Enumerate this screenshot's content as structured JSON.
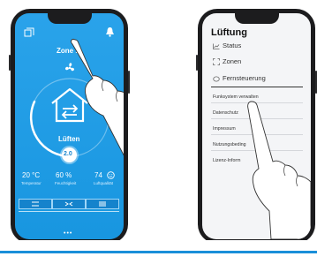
{
  "left_phone": {
    "zone_label": "Zone 1",
    "mode_label": "Lüften",
    "level_value": "2.0",
    "stats": [
      {
        "value": "20 °C",
        "label": "Temperatur"
      },
      {
        "value": "60 %",
        "label": "Feuchtigkeit"
      },
      {
        "value": "74",
        "label": "Luftqualität",
        "icon": "smiley-icon"
      }
    ],
    "mode_buttons": [
      {
        "icon": "menu-lines-icon",
        "active": false
      },
      {
        "icon": "crossflow-icon",
        "active": true
      },
      {
        "icon": "sliders-icon",
        "active": false
      }
    ],
    "page_dots": "•••",
    "icons": {
      "top_left": "rooms-icon",
      "top_right": "bell-icon",
      "fan": "fan-icon",
      "house": "house-recovery-icon"
    },
    "colors": {
      "background": "#1e9be4",
      "accent": "#ffffff"
    }
  },
  "right_phone": {
    "title": "Lüftung",
    "menu": [
      {
        "icon": "chart-icon",
        "label": "Status"
      },
      {
        "icon": "zones-icon",
        "label": "Zonen"
      },
      {
        "icon": "remote-icon",
        "label": "Fernsteuerung"
      }
    ],
    "sub_menu": [
      "Funksystem verwalten",
      "Datenschutz",
      "Impressum",
      "Nutzungsbeding",
      "Lizenz-Inform"
    ]
  }
}
